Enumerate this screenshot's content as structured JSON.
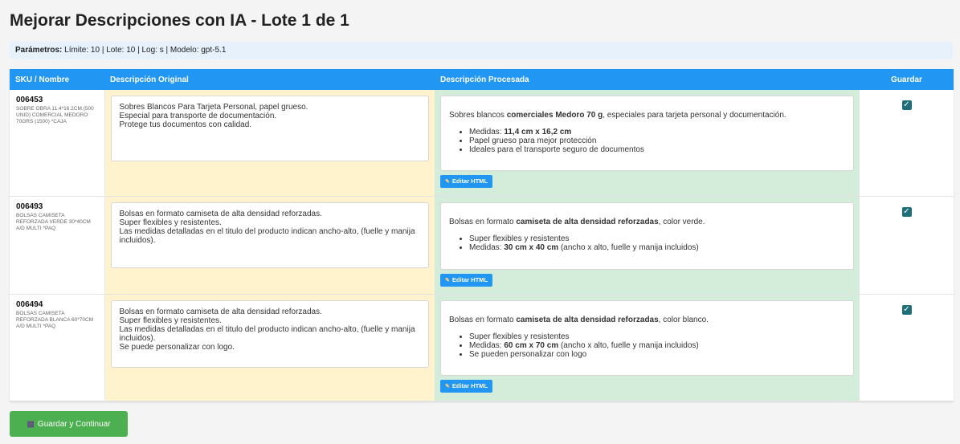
{
  "title": "Mejorar Descripciones con IA - Lote 1 de 1",
  "params": {
    "label": "Parámetros:",
    "text": " Límite: 10 | Lote: 10 | Log: s | Modelo: gpt-5.1"
  },
  "headers": {
    "sku": "SKU / Nombre",
    "original": "Descripción Original",
    "processed": "Descripción Procesada",
    "save": "Guardar"
  },
  "edit_label": "Editar HTML",
  "save_button": "Guardar y Continuar",
  "rows": [
    {
      "sku": "006453",
      "name": "SOBRE OBRA 11.4*16.2CM.(500 UNID) COMERCIAL MEDORO 70GRS (1500) *CAJA",
      "original": [
        "Sobres Blancos Para Tarjeta Personal, papel grueso.",
        "Especial para transporte de documentación.",
        "Protege tus documentos con calidad."
      ],
      "processed": {
        "p_pre": "Sobres blancos ",
        "p_bold": "comerciales Medoro 70 g",
        "p_post": ", especiales para tarjeta personal y documentación.",
        "items": [
          {
            "pre": "Medidas: ",
            "bold": "11,4 cm x 16,2 cm",
            "post": ""
          },
          {
            "pre": "Papel grueso para mejor protección",
            "bold": "",
            "post": ""
          },
          {
            "pre": "Ideales para el transporte seguro de documentos",
            "bold": "",
            "post": ""
          }
        ]
      },
      "checked": true
    },
    {
      "sku": "006493",
      "name": "BOLSAS CAMISETA REFORZADA VERDE 30*40CM A/D MULTI *PAQ",
      "original": [
        "Bolsas en formato camiseta de alta densidad reforzadas.",
        "Super flexibles y resistentes.",
        "Las medidas detalladas en el titulo del producto indican ancho-alto, (fuelle y manija incluidos)."
      ],
      "processed": {
        "p_pre": "Bolsas en formato ",
        "p_bold": "camiseta de alta densidad reforzadas",
        "p_post": ", color verde.",
        "items": [
          {
            "pre": "Super flexibles y resistentes",
            "bold": "",
            "post": ""
          },
          {
            "pre": "Medidas: ",
            "bold": "30 cm x 40 cm",
            "post": " (ancho x alto, fuelle y manija incluidos)"
          }
        ]
      },
      "checked": true
    },
    {
      "sku": "006494",
      "name": "BOLSAS CAMISETA REFORZADA BLANCA 60*70CM A/D MULTI *PAQ",
      "original": [
        "Bolsas en formato camiseta de alta densidad reforzadas.",
        "Super flexibles y resistentes.",
        "Las medidas detalladas en el titulo del producto indican ancho-alto, (fuelle y manija incluidos).",
        "Se puede personalizar con logo."
      ],
      "processed": {
        "p_pre": "Bolsas en formato ",
        "p_bold": "camiseta de alta densidad reforzadas",
        "p_post": ", color blanco.",
        "items": [
          {
            "pre": "Super flexibles y resistentes",
            "bold": "",
            "post": ""
          },
          {
            "pre": "Medidas: ",
            "bold": "60 cm x 70 cm",
            "post": " (ancho x alto, fuelle y manija incluidos)"
          },
          {
            "pre": "Se pueden personalizar con logo",
            "bold": "",
            "post": ""
          }
        ]
      },
      "checked": true
    }
  ]
}
